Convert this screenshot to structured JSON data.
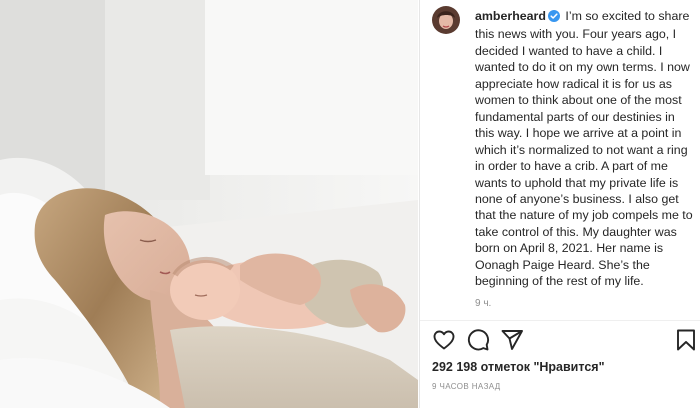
{
  "post": {
    "username": "amberheard",
    "caption": "I’m so excited to share this news with you. Four years ago, I decided I wanted to have a child. I wanted to do it on my own terms. I now appreciate how radical it is for us as women to think about one of the most fundamental parts of our destinies in this way. I hope we arrive at a point in which it’s normalized to not want a ring in order to have a crib. A part of me wants to uphold that my private life is none of anyone’s business. I also get that the nature of my job compels me to take control of this. My daughter was born on April 8, 2021. Her name is Oonagh Paige Heard. She’s the beginning of the rest of my life.",
    "caption_time": "9 ч.",
    "likes_text": "292 198 отметок \"Нравится\"",
    "date_text": "9 ЧАСОВ НАЗАД"
  },
  "icons": {
    "verified": "verified-badge-icon",
    "like": "heart-icon",
    "comment": "comment-icon",
    "share": "paper-plane-icon",
    "save": "bookmark-icon"
  },
  "colors": {
    "verified_blue": "#3897f0",
    "text": "#262626",
    "muted": "#8e8e8e"
  }
}
